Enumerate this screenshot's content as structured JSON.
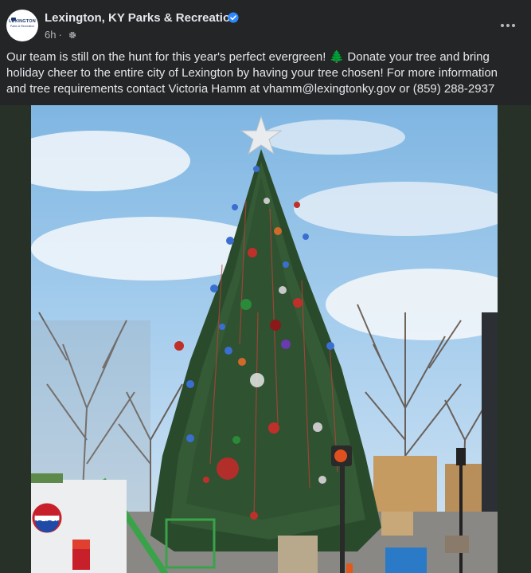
{
  "post": {
    "page_name": "Lexington, KY Parks & Recreation",
    "timestamp": "6h",
    "separator": "·",
    "audience_icon": "gear-icon",
    "verified_icon": "verified-badge-icon",
    "more_icon": "more-horizontal-icon",
    "avatar": {
      "title": "LEXINGTON",
      "subtitle": "Parks & Recreation"
    },
    "text": {
      "part1": "Our team is still on the hunt for this year's perfect evergreen! ",
      "emoji": "🌲",
      "part2": " Donate your tree and bring holiday cheer to the entire city of Lexington by having your tree chosen! For more information and tree requirements contact Victoria Hamm at vhamm@lexingtonky.gov or (859) 288-2937"
    }
  },
  "photo": {
    "truck_logo": "PEPSI"
  },
  "colors": {
    "background": "#242526",
    "text_primary": "#e4e6eb",
    "text_secondary": "#b0b3b8",
    "verified": "#2d88ff",
    "media_backdrop": "#273127"
  }
}
